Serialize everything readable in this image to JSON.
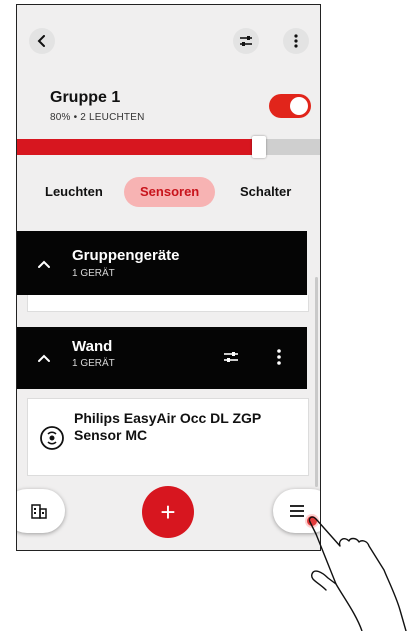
{
  "header": {
    "icons": [
      "chevron-left-icon",
      "sliders-icon",
      "more-vertical-icon"
    ]
  },
  "group": {
    "title": "Gruppe 1",
    "subtitle": "80% • 2 LEUCHTEN",
    "enabled": true,
    "brightness_fraction": 0.8
  },
  "tabs": [
    {
      "label": "Leuchten",
      "active": false
    },
    {
      "label": "Sensoren",
      "active": true
    },
    {
      "label": "Schalter",
      "active": false
    }
  ],
  "sections": [
    {
      "title": "Gruppengeräte",
      "subtitle": "1 GERÄT",
      "expanded": true
    },
    {
      "title": "Wand",
      "subtitle": "1 GERÄT",
      "expanded": true,
      "icons": [
        "sliders-icon",
        "more-vertical-icon"
      ]
    }
  ],
  "sensor": {
    "name": "Philips EasyAir Occ DL ZGP Sensor MC",
    "icon": "sensor-icon"
  },
  "bottom": {
    "add_label": "+",
    "icons": [
      "building-icon",
      "plus-icon",
      "menu-icon"
    ]
  },
  "colors": {
    "accent": "#d7161f",
    "tab_active_bg": "#f7b3b3",
    "header_bg": "#050505",
    "page_bg": "#f0efef"
  }
}
